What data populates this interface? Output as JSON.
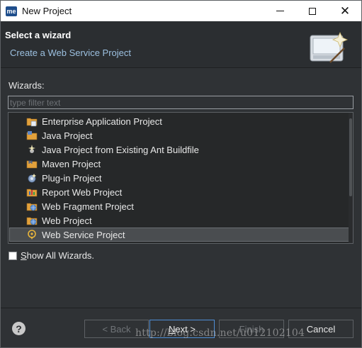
{
  "window": {
    "app_icon_text": "me",
    "title": "New Project"
  },
  "header": {
    "title": "Select a wizard",
    "subtitle": "Create a Web Service Project"
  },
  "wizards": {
    "label": "Wizards:",
    "filter_placeholder": "type filter text",
    "items": [
      {
        "label": "Enterprise Application Project",
        "icon": "enterprise-project-icon"
      },
      {
        "label": "Java Project",
        "icon": "java-project-icon"
      },
      {
        "label": "Java Project from Existing Ant Buildfile",
        "icon": "ant-buildfile-icon"
      },
      {
        "label": "Maven Project",
        "icon": "maven-project-icon"
      },
      {
        "label": "Plug-in Project",
        "icon": "plugin-project-icon"
      },
      {
        "label": "Report Web Project",
        "icon": "report-web-project-icon"
      },
      {
        "label": "Web Fragment Project",
        "icon": "web-fragment-project-icon"
      },
      {
        "label": "Web Project",
        "icon": "web-project-icon"
      },
      {
        "label": "Web Service Project",
        "icon": "web-service-project-icon",
        "selected": true
      }
    ]
  },
  "options": {
    "show_all_prefix": "S",
    "show_all_rest": "how All Wizards.",
    "show_all_checked": false
  },
  "buttons": {
    "help": "?",
    "back": "< Back",
    "next_prefix": "N",
    "next_rest": "ext >",
    "finish": "Finish",
    "cancel": "Cancel"
  },
  "watermark": "http://blog.csdn.net/u012102104",
  "colors": {
    "background": "#2f3235",
    "selection": "#4a4d50",
    "link_text": "#9cc0e0",
    "default_button_border": "#4f8fd6"
  }
}
